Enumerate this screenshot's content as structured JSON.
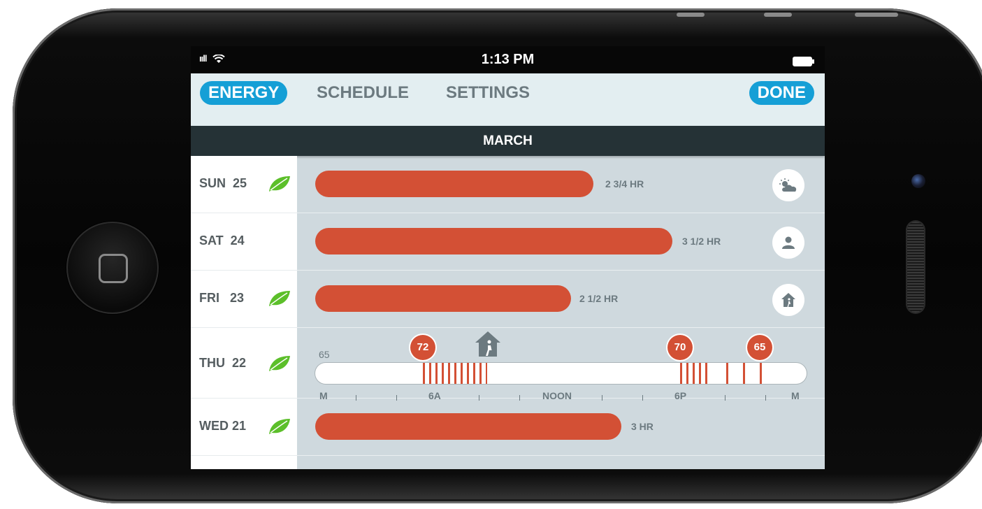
{
  "status": {
    "signal": "ııll",
    "time": "1:13 PM"
  },
  "tabs": [
    {
      "label": "ENERGY",
      "active": true
    },
    {
      "label": "SCHEDULE",
      "active": false
    },
    {
      "label": "SETTINGS",
      "active": false
    }
  ],
  "done_label": "DONE",
  "month": "MARCH",
  "colors": {
    "accent": "#159fd6",
    "usage_bar": "#d35035",
    "leaf": "#5cbf2a",
    "header_dark": "#253236"
  },
  "days": [
    {
      "label": "SUN  25",
      "leaf": true,
      "usage_hours": 2.75,
      "usage": "2 3/4 HR",
      "icon": "weather-icon"
    },
    {
      "label": "SAT  24",
      "leaf": false,
      "usage_hours": 3.5,
      "usage": "3 1/2 HR",
      "icon": "person-icon"
    },
    {
      "label": "FRI   23",
      "leaf": true,
      "usage_hours": 2.5,
      "usage": "2 1/2 HR",
      "icon": "home-away-icon"
    },
    {
      "label": "THU  22",
      "leaf": true,
      "detail": true
    },
    {
      "label": "WED 21",
      "leaf": true,
      "usage_hours": 3,
      "usage": "3 HR"
    }
  ],
  "thursday_detail": {
    "start_temp": "65",
    "setpoints": [
      "72",
      "70",
      "65"
    ],
    "axis_labels": [
      "M",
      "6A",
      "NOON",
      "6P",
      "M"
    ]
  }
}
